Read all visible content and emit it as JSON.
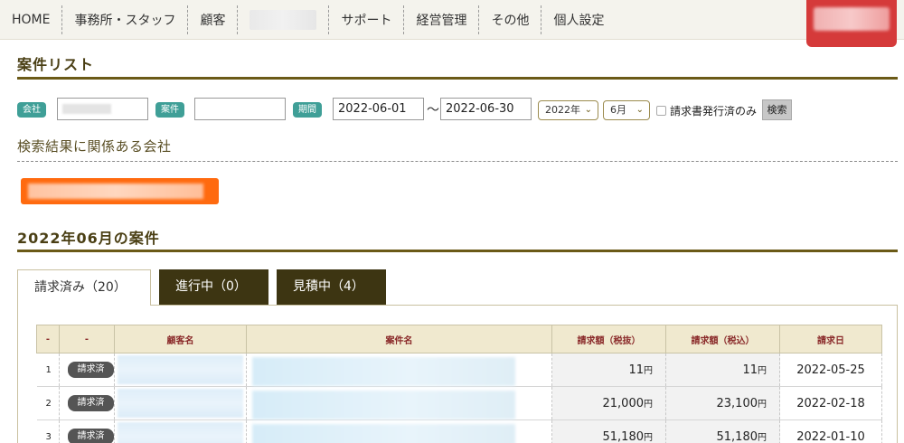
{
  "nav": {
    "items": [
      "HOME",
      "事務所・スタッフ",
      "顧客",
      "",
      "サポート",
      "経営管理",
      "その他",
      "個人設定"
    ]
  },
  "page_title": "案件リスト",
  "search": {
    "company_label": "会社",
    "case_label": "案件",
    "period_label": "期間",
    "date_from": "2022-06-01",
    "tilde": "〜",
    "date_to": "2022-06-30",
    "year_select": "2022年",
    "month_select": "6月",
    "invoiced_only_label": "請求書発行済のみ",
    "search_button": "検索"
  },
  "related_companies_heading": "検索結果に関係ある会社",
  "month_heading": "2022年06月の案件",
  "tabs": [
    {
      "label": "請求済み（20）",
      "active": true
    },
    {
      "label": "進行中（0）",
      "active": false
    },
    {
      "label": "見積中（4）",
      "active": false
    }
  ],
  "table": {
    "headers": [
      "-",
      "-",
      "顧客名",
      "案件名",
      "請求額（税抜）",
      "請求額（税込）",
      "請求日"
    ],
    "rows": [
      {
        "no": "1",
        "status": "請求済",
        "amount_ex": "11",
        "amount_in": "11",
        "date": "2022-05-25"
      },
      {
        "no": "2",
        "status": "請求済",
        "amount_ex": "21,000",
        "amount_in": "23,100",
        "date": "2022-02-18"
      },
      {
        "no": "3",
        "status": "請求済",
        "amount_ex": "51,180",
        "amount_in": "51,180",
        "date": "2022-01-10"
      }
    ],
    "yen": "円"
  },
  "colors": {
    "accent_dark": "#3d3512",
    "rule": "#6b5a17",
    "tag": "#3f9f97",
    "user_box": "#d53a3a",
    "company_chip": "#ff6a0f"
  }
}
